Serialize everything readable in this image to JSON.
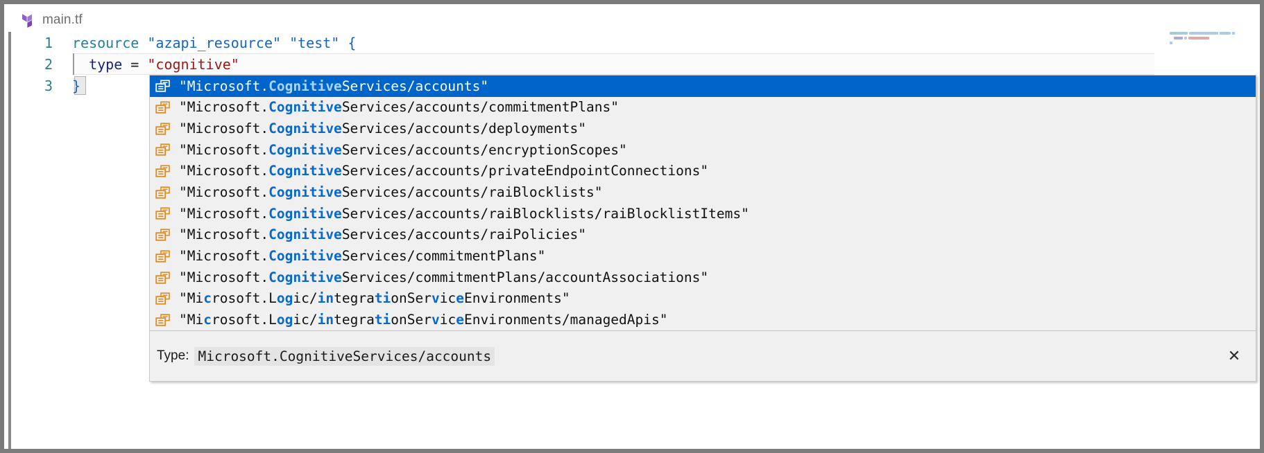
{
  "window": {
    "border_color": "#7b7b7b"
  },
  "tab": {
    "title": "main.tf",
    "icon": "terraform-icon",
    "icon_color": "#7b42bc"
  },
  "editor": {
    "lines": [
      {
        "number": "1",
        "tokens": [
          {
            "text": "resource ",
            "kind": "keyword"
          },
          {
            "text": "\"azapi_resource\"",
            "kind": "string-blue"
          },
          {
            "text": " ",
            "kind": "plain"
          },
          {
            "text": "\"test\"",
            "kind": "string-blue"
          },
          {
            "text": " ",
            "kind": "plain"
          },
          {
            "text": "{",
            "kind": "brace"
          }
        ]
      },
      {
        "number": "2",
        "tokens": [
          {
            "text": "  ",
            "kind": "plain"
          },
          {
            "text": "type",
            "kind": "ident"
          },
          {
            "text": " = ",
            "kind": "op"
          },
          {
            "text": "\"cognitive\"",
            "kind": "string-red"
          }
        ]
      },
      {
        "number": "3",
        "tokens": [
          {
            "text": "}",
            "kind": "brace"
          }
        ]
      }
    ],
    "line_number_color": "#2b7f8c"
  },
  "minimap": {
    "name": "code-minimap"
  },
  "autocomplete": {
    "selected_index": 0,
    "selection_color": "#0065ca",
    "background_color": "#f0f0f0",
    "highlight_color": "#0a68c8",
    "icon_color": "#e08a1e",
    "items": [
      {
        "icon": "resource-type-icon",
        "segments": [
          {
            "text": "\"Microsoft.",
            "bold": false
          },
          {
            "text": "Cognitive",
            "bold": true
          },
          {
            "text": "Services/accounts\"",
            "bold": false
          }
        ]
      },
      {
        "icon": "resource-type-icon",
        "segments": [
          {
            "text": "\"Microsoft.",
            "bold": false
          },
          {
            "text": "Cognitive",
            "bold": true
          },
          {
            "text": "Services/accounts/commitmentPlans\"",
            "bold": false
          }
        ]
      },
      {
        "icon": "resource-type-icon",
        "segments": [
          {
            "text": "\"Microsoft.",
            "bold": false
          },
          {
            "text": "Cognitive",
            "bold": true
          },
          {
            "text": "Services/accounts/deployments\"",
            "bold": false
          }
        ]
      },
      {
        "icon": "resource-type-icon",
        "segments": [
          {
            "text": "\"Microsoft.",
            "bold": false
          },
          {
            "text": "Cognitive",
            "bold": true
          },
          {
            "text": "Services/accounts/encryptionScopes\"",
            "bold": false
          }
        ]
      },
      {
        "icon": "resource-type-icon",
        "segments": [
          {
            "text": "\"Microsoft.",
            "bold": false
          },
          {
            "text": "Cognitive",
            "bold": true
          },
          {
            "text": "Services/accounts/privateEndpointConnections\"",
            "bold": false
          }
        ]
      },
      {
        "icon": "resource-type-icon",
        "segments": [
          {
            "text": "\"Microsoft.",
            "bold": false
          },
          {
            "text": "Cognitive",
            "bold": true
          },
          {
            "text": "Services/accounts/raiBlocklists\"",
            "bold": false
          }
        ]
      },
      {
        "icon": "resource-type-icon",
        "segments": [
          {
            "text": "\"Microsoft.",
            "bold": false
          },
          {
            "text": "Cognitive",
            "bold": true
          },
          {
            "text": "Services/accounts/raiBlocklists/raiBlocklistItems\"",
            "bold": false
          }
        ]
      },
      {
        "icon": "resource-type-icon",
        "segments": [
          {
            "text": "\"Microsoft.",
            "bold": false
          },
          {
            "text": "Cognitive",
            "bold": true
          },
          {
            "text": "Services/accounts/raiPolicies\"",
            "bold": false
          }
        ]
      },
      {
        "icon": "resource-type-icon",
        "segments": [
          {
            "text": "\"Microsoft.",
            "bold": false
          },
          {
            "text": "Cognitive",
            "bold": true
          },
          {
            "text": "Services/commitmentPlans\"",
            "bold": false
          }
        ]
      },
      {
        "icon": "resource-type-icon",
        "segments": [
          {
            "text": "\"Microsoft.",
            "bold": false
          },
          {
            "text": "Cognitive",
            "bold": true
          },
          {
            "text": "Services/commitmentPlans/accountAssociations\"",
            "bold": false
          }
        ]
      },
      {
        "icon": "resource-type-icon",
        "segments": [
          {
            "text": "\"Mi",
            "bold": false
          },
          {
            "text": "c",
            "bold": true
          },
          {
            "text": "rosoft.L",
            "bold": false
          },
          {
            "text": "og",
            "bold": true
          },
          {
            "text": "ic/",
            "bold": false
          },
          {
            "text": "in",
            "bold": true
          },
          {
            "text": "tegra",
            "bold": false
          },
          {
            "text": "ti",
            "bold": true
          },
          {
            "text": "onSer",
            "bold": false
          },
          {
            "text": "v",
            "bold": true
          },
          {
            "text": "ic",
            "bold": false
          },
          {
            "text": "e",
            "bold": true
          },
          {
            "text": "Environments\"",
            "bold": false
          }
        ]
      },
      {
        "icon": "resource-type-icon",
        "segments": [
          {
            "text": "\"Mi",
            "bold": false
          },
          {
            "text": "c",
            "bold": true
          },
          {
            "text": "rosoft.L",
            "bold": false
          },
          {
            "text": "og",
            "bold": true
          },
          {
            "text": "ic/",
            "bold": false
          },
          {
            "text": "in",
            "bold": true
          },
          {
            "text": "tegra",
            "bold": false
          },
          {
            "text": "ti",
            "bold": true
          },
          {
            "text": "onSer",
            "bold": false
          },
          {
            "text": "v",
            "bold": true
          },
          {
            "text": "ic",
            "bold": false
          },
          {
            "text": "e",
            "bold": true
          },
          {
            "text": "Environments/managedApis\"",
            "bold": false
          }
        ]
      }
    ]
  },
  "documentation": {
    "label": "Type:",
    "value": "Microsoft.CognitiveServices/accounts",
    "close_icon": "close-icon",
    "close_glyph": "✕"
  }
}
